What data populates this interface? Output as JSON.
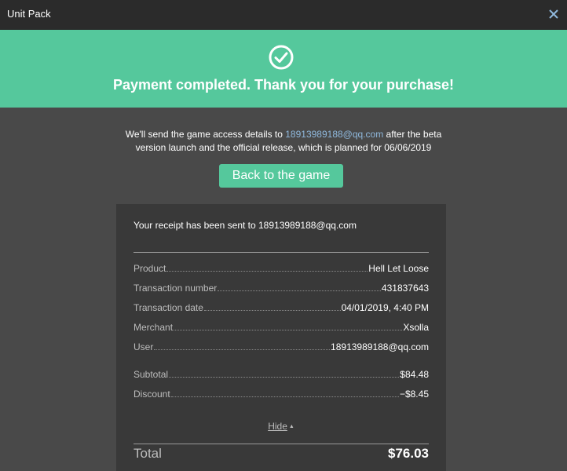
{
  "window": {
    "title": "Unit Pack"
  },
  "banner": {
    "message": "Payment completed. Thank you for your purchase!"
  },
  "notice": {
    "before": "We'll send the game access details to ",
    "email": "18913989188@qq.com",
    "after": " after the beta version launch and the official release, which is planned for 06/06/2019"
  },
  "back_button": {
    "label": "Back to the game"
  },
  "receipt": {
    "sent_text": "Your receipt has been sent to 18913989188@qq.com",
    "details": [
      {
        "label": "Product",
        "value": "Hell Let Loose"
      },
      {
        "label": "Transaction number",
        "value": "431837643"
      },
      {
        "label": "Transaction date",
        "value": "04/01/2019, 4:40 PM"
      },
      {
        "label": "Merchant",
        "value": "Xsolla"
      },
      {
        "label": "User",
        "value": "18913989188@qq.com"
      }
    ],
    "amounts": [
      {
        "label": "Subtotal",
        "value": "$84.48"
      },
      {
        "label": "Discount",
        "value": "−$8.45"
      }
    ],
    "hide_label": "Hide",
    "total_label": "Total",
    "total_value": "$76.03"
  },
  "colors": {
    "accent_green": "#55c89c",
    "link_blue": "#8fb8dc",
    "background": "#494949",
    "receipt_panel": "#393939",
    "titlebar": "#2b2b2b"
  },
  "icons": {
    "close": "close-icon",
    "success": "check-circle-icon",
    "hide_caret": "caret-up-icon"
  }
}
